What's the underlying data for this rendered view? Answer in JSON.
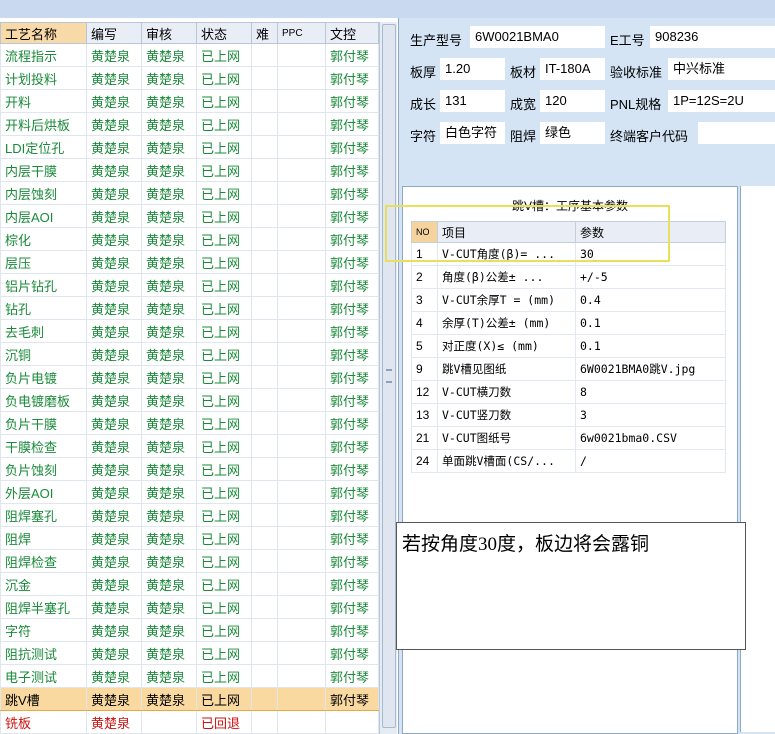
{
  "process_grid": {
    "headers": [
      "工艺名称",
      "编写",
      "审核",
      "状态",
      "难",
      "PPC",
      "文控"
    ],
    "rows": [
      {
        "name": "流程指示",
        "author": "黄楚泉",
        "reviewer": "黄楚泉",
        "status": "已上网",
        "difficulty": "",
        "ppc": "",
        "doc_control": "郭付琴"
      },
      {
        "name": "计划投料",
        "author": "黄楚泉",
        "reviewer": "黄楚泉",
        "status": "已上网",
        "difficulty": "",
        "ppc": "",
        "doc_control": "郭付琴"
      },
      {
        "name": "开料",
        "author": "黄楚泉",
        "reviewer": "黄楚泉",
        "status": "已上网",
        "difficulty": "",
        "ppc": "",
        "doc_control": "郭付琴"
      },
      {
        "name": "开料后烘板",
        "author": "黄楚泉",
        "reviewer": "黄楚泉",
        "status": "已上网",
        "difficulty": "",
        "ppc": "",
        "doc_control": "郭付琴"
      },
      {
        "name": "LDI定位孔",
        "author": "黄楚泉",
        "reviewer": "黄楚泉",
        "status": "已上网",
        "difficulty": "",
        "ppc": "",
        "doc_control": "郭付琴"
      },
      {
        "name": "内层干膜",
        "author": "黄楚泉",
        "reviewer": "黄楚泉",
        "status": "已上网",
        "difficulty": "",
        "ppc": "",
        "doc_control": "郭付琴"
      },
      {
        "name": "内层蚀刻",
        "author": "黄楚泉",
        "reviewer": "黄楚泉",
        "status": "已上网",
        "difficulty": "",
        "ppc": "",
        "doc_control": "郭付琴"
      },
      {
        "name": "内层AOI",
        "author": "黄楚泉",
        "reviewer": "黄楚泉",
        "status": "已上网",
        "difficulty": "",
        "ppc": "",
        "doc_control": "郭付琴"
      },
      {
        "name": "棕化",
        "author": "黄楚泉",
        "reviewer": "黄楚泉",
        "status": "已上网",
        "difficulty": "",
        "ppc": "",
        "doc_control": "郭付琴"
      },
      {
        "name": "层压",
        "author": "黄楚泉",
        "reviewer": "黄楚泉",
        "status": "已上网",
        "difficulty": "",
        "ppc": "",
        "doc_control": "郭付琴"
      },
      {
        "name": "铝片钻孔",
        "author": "黄楚泉",
        "reviewer": "黄楚泉",
        "status": "已上网",
        "difficulty": "",
        "ppc": "",
        "doc_control": "郭付琴"
      },
      {
        "name": "钻孔",
        "author": "黄楚泉",
        "reviewer": "黄楚泉",
        "status": "已上网",
        "difficulty": "",
        "ppc": "",
        "doc_control": "郭付琴"
      },
      {
        "name": "去毛刺",
        "author": "黄楚泉",
        "reviewer": "黄楚泉",
        "status": "已上网",
        "difficulty": "",
        "ppc": "",
        "doc_control": "郭付琴"
      },
      {
        "name": "沉铜",
        "author": "黄楚泉",
        "reviewer": "黄楚泉",
        "status": "已上网",
        "difficulty": "",
        "ppc": "",
        "doc_control": "郭付琴"
      },
      {
        "name": "负片电镀",
        "author": "黄楚泉",
        "reviewer": "黄楚泉",
        "status": "已上网",
        "difficulty": "",
        "ppc": "",
        "doc_control": "郭付琴"
      },
      {
        "name": "负电镀磨板",
        "author": "黄楚泉",
        "reviewer": "黄楚泉",
        "status": "已上网",
        "difficulty": "",
        "ppc": "",
        "doc_control": "郭付琴"
      },
      {
        "name": "负片干膜",
        "author": "黄楚泉",
        "reviewer": "黄楚泉",
        "status": "已上网",
        "difficulty": "",
        "ppc": "",
        "doc_control": "郭付琴"
      },
      {
        "name": "干膜检查",
        "author": "黄楚泉",
        "reviewer": "黄楚泉",
        "status": "已上网",
        "difficulty": "",
        "ppc": "",
        "doc_control": "郭付琴"
      },
      {
        "name": "负片蚀刻",
        "author": "黄楚泉",
        "reviewer": "黄楚泉",
        "status": "已上网",
        "difficulty": "",
        "ppc": "",
        "doc_control": "郭付琴"
      },
      {
        "name": "外层AOI",
        "author": "黄楚泉",
        "reviewer": "黄楚泉",
        "status": "已上网",
        "difficulty": "",
        "ppc": "",
        "doc_control": "郭付琴"
      },
      {
        "name": "阻焊塞孔",
        "author": "黄楚泉",
        "reviewer": "黄楚泉",
        "status": "已上网",
        "difficulty": "",
        "ppc": "",
        "doc_control": "郭付琴"
      },
      {
        "name": "阻焊",
        "author": "黄楚泉",
        "reviewer": "黄楚泉",
        "status": "已上网",
        "difficulty": "",
        "ppc": "",
        "doc_control": "郭付琴"
      },
      {
        "name": "阻焊检查",
        "author": "黄楚泉",
        "reviewer": "黄楚泉",
        "status": "已上网",
        "difficulty": "",
        "ppc": "",
        "doc_control": "郭付琴"
      },
      {
        "name": "沉金",
        "author": "黄楚泉",
        "reviewer": "黄楚泉",
        "status": "已上网",
        "difficulty": "",
        "ppc": "",
        "doc_control": "郭付琴"
      },
      {
        "name": "阻焊半塞孔",
        "author": "黄楚泉",
        "reviewer": "黄楚泉",
        "status": "已上网",
        "difficulty": "",
        "ppc": "",
        "doc_control": "郭付琴"
      },
      {
        "name": "字符",
        "author": "黄楚泉",
        "reviewer": "黄楚泉",
        "status": "已上网",
        "difficulty": "",
        "ppc": "",
        "doc_control": "郭付琴"
      },
      {
        "name": "阻抗测试",
        "author": "黄楚泉",
        "reviewer": "黄楚泉",
        "status": "已上网",
        "difficulty": "",
        "ppc": "",
        "doc_control": "郭付琴"
      },
      {
        "name": "电子测试",
        "author": "黄楚泉",
        "reviewer": "黄楚泉",
        "status": "已上网",
        "difficulty": "",
        "ppc": "",
        "doc_control": "郭付琴"
      },
      {
        "name": "跳V槽",
        "author": "黄楚泉",
        "reviewer": "黄楚泉",
        "status": "已上网",
        "difficulty": "",
        "ppc": "",
        "doc_control": "郭付琴"
      },
      {
        "name": "铣板",
        "author": "黄楚泉",
        "reviewer": "",
        "status": "已回退",
        "difficulty": "",
        "ppc": "",
        "doc_control": ""
      }
    ],
    "selected_index": 28,
    "returned_index": 29,
    "colors": {
      "approved_text": "#1a8a3a",
      "returned_text": "#cc1111",
      "selected_row": "#f9d9a0"
    }
  },
  "info": {
    "model_label": "生产型号",
    "model_value": "6W0021BMA0",
    "eno_label": "E工号",
    "eno_value": "908236",
    "thickness_label": "板厚",
    "thickness_value": "1.20",
    "material_label": "板材",
    "material_value": "IT-180A",
    "standard_label": "验收标准",
    "standard_value": "中兴标准",
    "length_label": "成长",
    "length_value": "131",
    "width_label": "成宽",
    "width_value": "120",
    "pnl_label": "PNL规格",
    "pnl_value": "1P=12S=2U",
    "legend_label": "字符",
    "legend_value": "白色字符",
    "mask_label": "阻焊",
    "mask_value": "绿色",
    "customer_label": "终端客户代码",
    "customer_value": ""
  },
  "params": {
    "caption": "跳V槽：工序基本参数",
    "headers": [
      "NO",
      "项目",
      "参数"
    ],
    "rows": [
      {
        "no": "1",
        "item": "V-CUT角度(β)=  ...",
        "value": "30"
      },
      {
        "no": "2",
        "item": "角度(β)公差±  ...",
        "value": "+/-5"
      },
      {
        "no": "3",
        "item": "V-CUT余厚T =  (mm)",
        "value": "0.4"
      },
      {
        "no": "4",
        "item": "余厚(T)公差±  (mm)",
        "value": "0.1"
      },
      {
        "no": "5",
        "item": "对正度(X)≤ (mm)",
        "value": "0.1"
      },
      {
        "no": "9",
        "item": "跳V槽见图纸",
        "value": "6W0021BMA0跳V.jpg"
      },
      {
        "no": "12",
        "item": "V-CUT横刀数",
        "value": "8"
      },
      {
        "no": "13",
        "item": "V-CUT竖刀数",
        "value": "3"
      },
      {
        "no": "21",
        "item": "V-CUT图纸号",
        "value": "6w0021bma0.CSV"
      },
      {
        "no": "24",
        "item": "单面跳V槽面(CS/...",
        "value": "/"
      }
    ]
  },
  "annotation": {
    "text": "若按角度30度，板边将会露铜",
    "highlight_color": "#e8e05a"
  }
}
